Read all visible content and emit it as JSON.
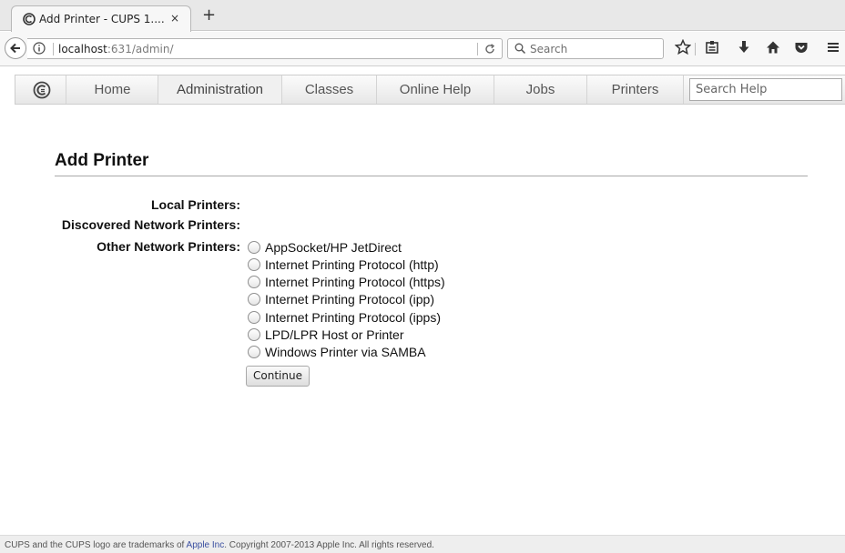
{
  "browser": {
    "tab_title": "Add Printer - CUPS 1....",
    "tab_close": "×",
    "new_tab": "+",
    "url_host": "localhost",
    "url_rest": ":631/admin/",
    "search_placeholder": "Search",
    "icons": [
      "back-arrow-icon",
      "info-icon",
      "reload-icon",
      "search-icon",
      "bookmark-star-icon",
      "reading-list-icon",
      "downloads-icon",
      "home-icon",
      "pocket-icon",
      "hamburger-menu-icon"
    ]
  },
  "cups_nav": {
    "tabs": [
      {
        "label": "Home"
      },
      {
        "label": "Administration"
      },
      {
        "label": "Classes"
      },
      {
        "label": "Online Help"
      },
      {
        "label": "Jobs"
      },
      {
        "label": "Printers"
      }
    ],
    "active_tab": "Administration",
    "search_placeholder": "Search Help"
  },
  "page": {
    "title": "Add Printer",
    "local_printers_label": "Local Printers:",
    "discovered_label": "Discovered Network Printers:",
    "other_label": "Other Network Printers:",
    "options": [
      {
        "label": "AppSocket/HP JetDirect"
      },
      {
        "label": "Internet Printing Protocol (http)"
      },
      {
        "label": "Internet Printing Protocol (https)"
      },
      {
        "label": "Internet Printing Protocol (ipp)"
      },
      {
        "label": "Internet Printing Protocol (ipps)"
      },
      {
        "label": "LPD/LPR Host or Printer"
      },
      {
        "label": "Windows Printer via SAMBA"
      }
    ],
    "continue_label": "Continue"
  },
  "footer": {
    "text_before": "CUPS and the CUPS logo are trademarks of ",
    "link_text": "Apple Inc",
    "text_after": ". Copyright 2007-2013 Apple Inc. All rights reserved."
  },
  "colors": {
    "link": "#3a4fa0",
    "active_tab_bg": "#f0f0f0"
  }
}
